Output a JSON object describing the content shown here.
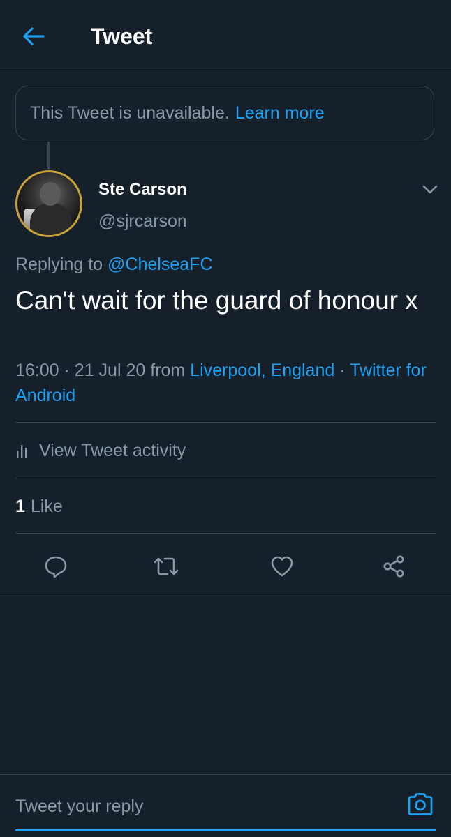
{
  "header": {
    "title": "Tweet",
    "back_icon": "arrow-left-icon"
  },
  "unavailable_notice": {
    "text": "This Tweet is unavailable.",
    "link": "Learn more"
  },
  "tweet": {
    "author": {
      "display_name": "Ste Carson",
      "handle": "@sjrcarson",
      "avatar_ring_color": "#c9a23a"
    },
    "replying_to_label": "Replying to",
    "replying_to_handle": "@ChelseaFC",
    "text": "Can't wait for the guard of honour x",
    "time": "16:00",
    "separator": "·",
    "date": "21 Jul 20",
    "from_label": "from",
    "location": "Liverpool, England",
    "source": "Twitter for Android"
  },
  "activity": {
    "label": "View Tweet activity",
    "icon": "bar-chart-icon"
  },
  "stats": {
    "likes_count": "1",
    "likes_label": "Like"
  },
  "actions": {
    "reply_icon": "reply-icon",
    "retweet_icon": "retweet-icon",
    "like_icon": "heart-icon",
    "share_icon": "share-icon"
  },
  "reply_bar": {
    "placeholder": "Tweet your reply",
    "camera_icon": "camera-icon"
  },
  "colors": {
    "background": "#15202b",
    "accent": "#1da1f2",
    "secondary_text": "#8899a6",
    "border": "#38444d"
  }
}
